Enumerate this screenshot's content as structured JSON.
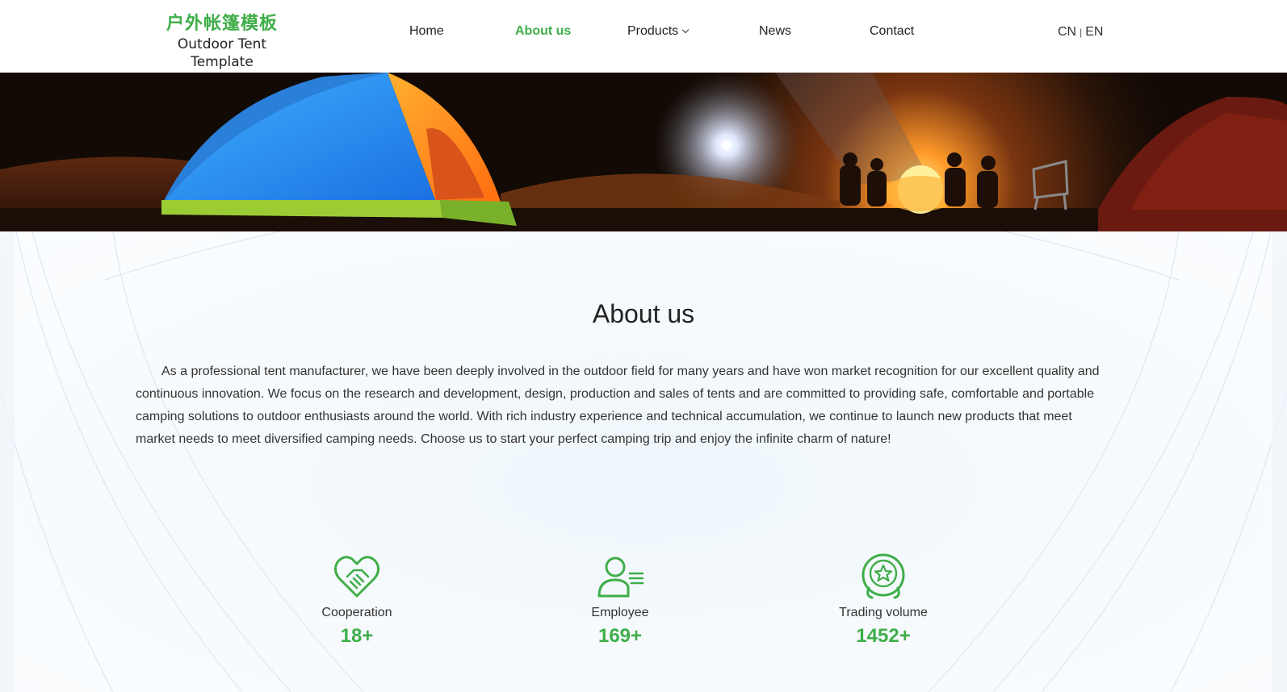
{
  "logo": {
    "cn": "户外帐篷模板",
    "en": "Outdoor Tent Template"
  },
  "nav": {
    "items": [
      {
        "label": "Home"
      },
      {
        "label": "About us"
      },
      {
        "label": "Products"
      },
      {
        "label": "News"
      },
      {
        "label": "Contact"
      }
    ],
    "active": "About us"
  },
  "lang": {
    "cn": "CN",
    "separator": "|",
    "en": "EN"
  },
  "about": {
    "title": "About us",
    "text": "As a professional tent manufacturer, we have been deeply involved in the outdoor field for many years and have won market recognition for our excellent quality and continuous innovation. We focus on the research and development, design, production and sales of tents and are committed to providing safe, comfortable and portable camping solutions to outdoor enthusiasts around the world. With rich industry experience and technical accumulation, we continue to launch new products that meet market needs to meet diversified camping needs. Choose us to start your perfect camping trip and enjoy the infinite charm of nature!"
  },
  "stats": [
    {
      "label": "Cooperation",
      "value": "18+",
      "icon": "handshake-heart-icon"
    },
    {
      "label": "Employee",
      "value": "169+",
      "icon": "user-list-icon"
    },
    {
      "label": "Trading volume",
      "value": "1452+",
      "icon": "star-badge-icon"
    }
  ],
  "colors": {
    "accent": "#3fae49",
    "text": "#333333"
  }
}
